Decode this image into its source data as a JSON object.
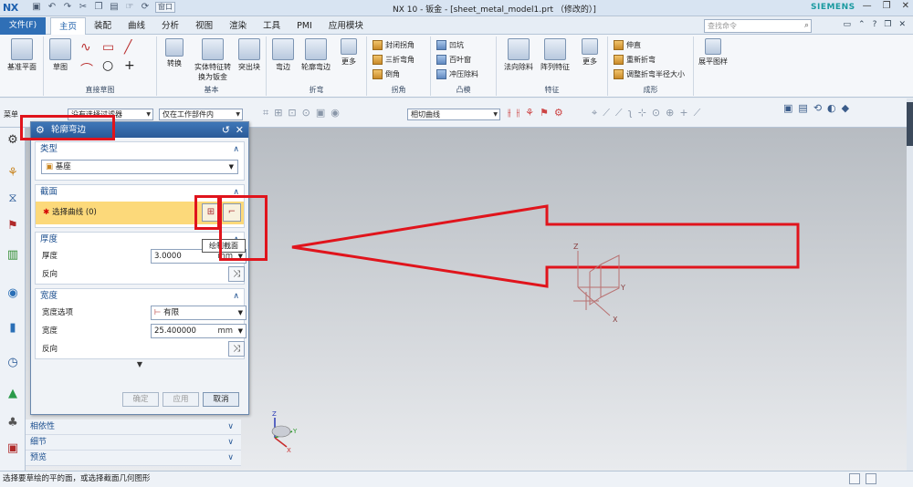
{
  "titlebar": {
    "logo": "NX",
    "window_menu": "窗口",
    "title": "NX 10 - 钣金 - [sheet_metal_model1.prt （修改的）]",
    "brand": "SIEMENS"
  },
  "menubar": {
    "file_menu": "文件(F)",
    "tabs": [
      "主页",
      "装配",
      "曲线",
      "分析",
      "视图",
      "渲染",
      "工具",
      "PMI",
      "应用模块"
    ],
    "search_placeholder": "查找命令"
  },
  "ribbon": {
    "groups": {
      "direct_sketch": "直接草图",
      "base": "基本",
      "bend": "折弯",
      "corner": "拐角",
      "punch": "凸模",
      "feature": "特征",
      "forming": "成形"
    },
    "buttons": {
      "datum_plane": "基准平面",
      "sketch": "草图",
      "convert": "转换",
      "solid_to_sheet": "实体特征转换为钣金",
      "tab": "突出块",
      "flange": "弯边",
      "contour_flange": "轮廓弯边",
      "more1": "更多",
      "closed_corner": "封闭拐角",
      "three_bend_corner": "三折弯角",
      "chamfer": "倒角",
      "dimple": "凹坑",
      "louver": "百叶窗",
      "punch_cutout": "冲压除料",
      "normal_cutout": "法向除料",
      "pattern_feature": "阵列特征",
      "more2": "更多",
      "unbend": "伸直",
      "rebend": "重新折弯",
      "adjust_radius": "调整折弯半径大小",
      "panel_layout": "展平图样"
    }
  },
  "seltool": {
    "filter_label": "菜单",
    "filter_value": "没有选择过滤器",
    "scope_value": "仅在工作部件内",
    "curve_rule": "相切曲线"
  },
  "dialog": {
    "title": "轮廓弯边",
    "type": {
      "header": "类型",
      "value": "基座"
    },
    "section": {
      "header": "截面",
      "select_curve": "选择曲线 (0)"
    },
    "thickness": {
      "header": "厚度",
      "label": "厚度",
      "value": "3.0000",
      "unit": "mm",
      "reverse": "反向"
    },
    "width": {
      "header": "宽度",
      "option_label": "宽度选项",
      "option_value": "有限",
      "label": "宽度",
      "value": "25.400000",
      "unit": "mm",
      "reverse": "反向"
    },
    "buttons": {
      "ok": "确定",
      "apply": "应用",
      "cancel": "取消"
    }
  },
  "tooltip": "绘制截面",
  "resource_rows": [
    "相依性",
    "细节",
    "预览"
  ],
  "csys": {
    "x": "X",
    "y": "Y",
    "z": "Z"
  },
  "status": "选择要草绘的平的面，或选择截面几何图形",
  "colors": {
    "annotation_red": "#e0141c",
    "title_blue": "#2a5a98",
    "select_highlight": "#fcd97a"
  }
}
